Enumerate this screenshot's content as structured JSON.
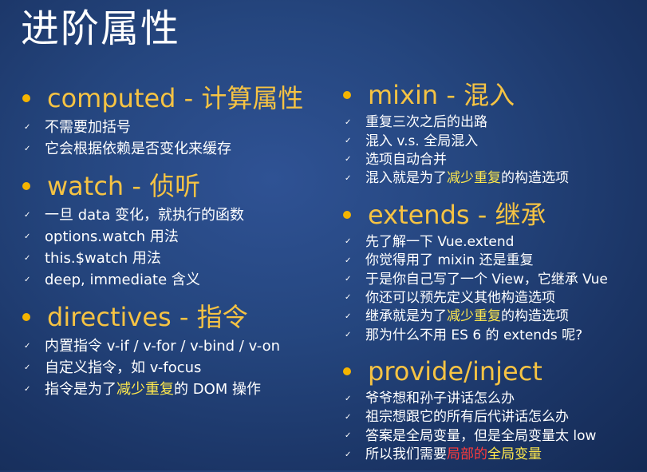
{
  "title": "进阶属性",
  "colors": {
    "accent": "#f6c343",
    "bullet": "#f4b400",
    "highlight": "#ffe84d",
    "alert": "#ff3b3b",
    "background": "#25467f"
  },
  "check_glyph": "✓",
  "left_sections": [
    {
      "heading": "computed - 计算属性",
      "items": [
        {
          "text": "不需要加括号"
        },
        {
          "text": "它会根据依赖是否变化来缓存"
        }
      ]
    },
    {
      "heading": "watch - 侦听",
      "items": [
        {
          "text": "一旦 data 变化，就执行的函数"
        },
        {
          "text": "options.watch 用法"
        },
        {
          "text": "this.$watch 用法"
        },
        {
          "text": "deep, immediate 含义"
        }
      ]
    },
    {
      "heading": "directives - 指令",
      "items": [
        {
          "text": "内置指令 v-if / v-for / v-bind / v-on"
        },
        {
          "text": "自定义指令，如 v-focus"
        },
        {
          "pre": "指令是为了",
          "highlight": "减少重复",
          "post": "的 DOM 操作"
        }
      ]
    }
  ],
  "right_sections": [
    {
      "heading": "mixin - 混入",
      "items": [
        {
          "text": "重复三次之后的出路"
        },
        {
          "text": "混入 v.s. 全局混入"
        },
        {
          "text": "选项自动合并"
        },
        {
          "pre": "混入就是为了",
          "highlight": "减少重复",
          "post": "的构造选项"
        }
      ]
    },
    {
      "heading": "extends - 继承",
      "items": [
        {
          "text": "先了解一下 Vue.extend"
        },
        {
          "text": "你觉得用了 mixin 还是重复"
        },
        {
          "text": "于是你自己写了一个 View，它继承 Vue"
        },
        {
          "text": "你还可以预先定义其他构造选项"
        },
        {
          "pre": "继承就是为了",
          "highlight": "减少重复",
          "post": "的构造选项"
        },
        {
          "text": "那为什么不用 ES 6 的 extends 呢?"
        }
      ]
    },
    {
      "heading": "provide/inject",
      "items": [
        {
          "text": "爷爷想和孙子讲话怎么办"
        },
        {
          "text": "祖宗想跟它的所有后代讲话怎么办"
        },
        {
          "text": "答案是全局变量，但是全局变量太 low"
        },
        {
          "pre": "所以我们需要",
          "red": "局部的",
          "highlight": "全局变量",
          "post": ""
        }
      ]
    }
  ]
}
